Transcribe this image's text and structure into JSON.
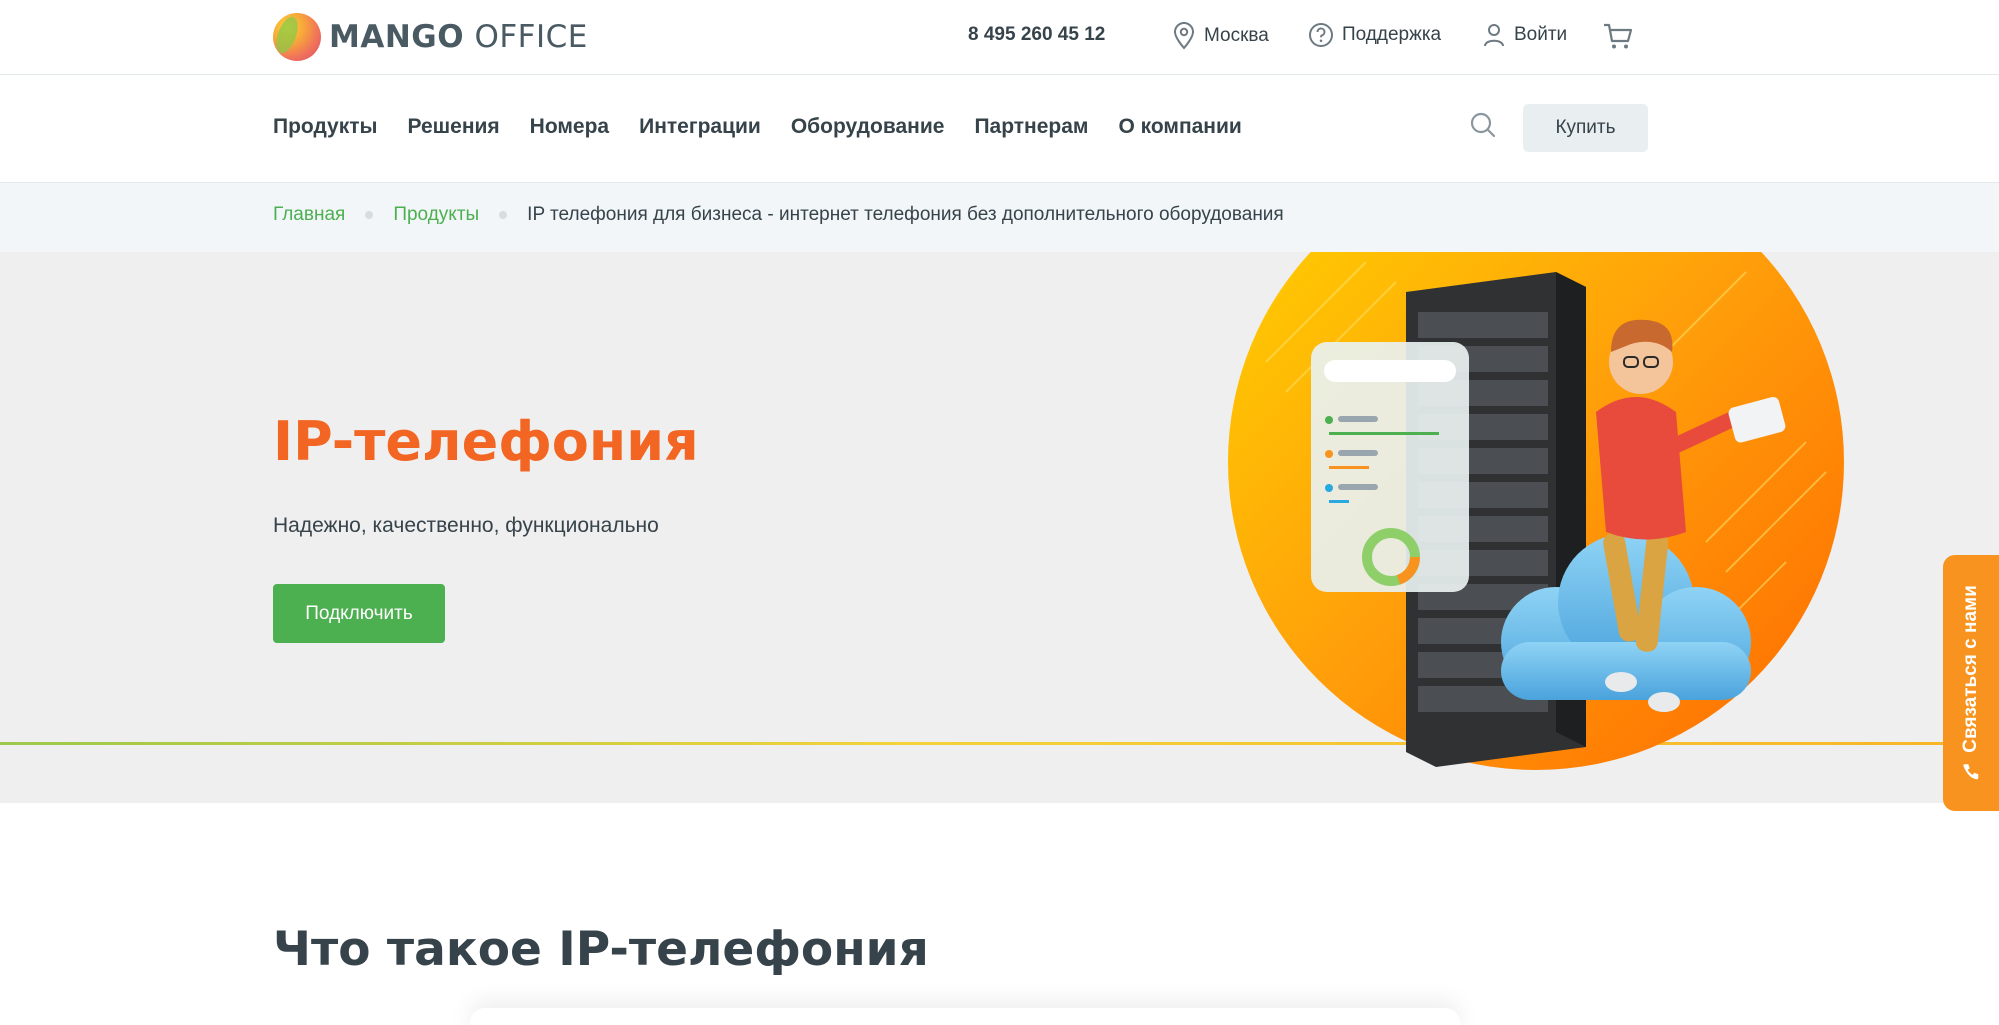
{
  "header": {
    "logo": {
      "brand": "MANGO",
      "suffix": "OFFICE"
    },
    "phone": "8 495 260 45 12",
    "city": "Москва",
    "support": "Поддержка",
    "login": "Войти",
    "icons": [
      "location-pin-icon",
      "question-circle-icon",
      "user-icon",
      "cart-icon"
    ]
  },
  "nav": {
    "items": [
      "Продукты",
      "Решения",
      "Номера",
      "Интеграции",
      "Оборудование",
      "Партнерам",
      "О компании"
    ],
    "buy_label": "Купить",
    "search_icon": "search-icon"
  },
  "breadcrumb": {
    "items": [
      "Главная",
      "Продукты"
    ],
    "current": "IP телефония для бизнеса - интернет телефония без дополнительного оборудования"
  },
  "hero": {
    "title": "IP-телефония",
    "subtitle": "Надежно, качественно, функционально",
    "button": "Подключить"
  },
  "contact_tab": {
    "label": "Связаться с нами",
    "icon": "phone-icon"
  },
  "section": {
    "title": "Что такое IP-телефония"
  },
  "colors": {
    "accent_orange": "#f26522",
    "accent_green": "#4caf50",
    "text_dark": "#36434a",
    "contact_tab": "#f7931e"
  }
}
